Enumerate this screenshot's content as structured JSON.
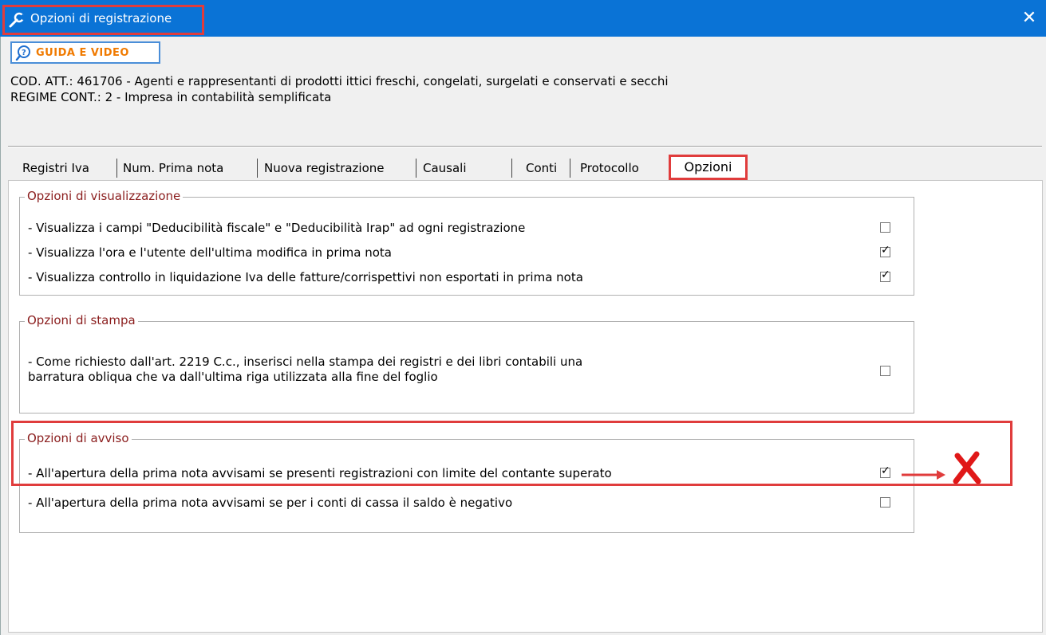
{
  "window": {
    "title": "Opzioni di registrazione",
    "close_glyph": "✕",
    "title_icon": "wrench-icon",
    "accent_color": "#0a73d6",
    "highlight_color": "#e03c3c"
  },
  "help_button": {
    "label": "GUIDA E VIDEO",
    "icon": "search-icon"
  },
  "info": {
    "activity_line": "COD. ATT.: 461706 - Agenti e rappresentanti di prodotti ittici freschi, congelati, surgelati e conservati e secchi",
    "regime_line": "REGIME CONT.: 2 - Impresa  in contabilità semplificata"
  },
  "tabs": [
    {
      "label": "Registri Iva"
    },
    {
      "label": "Num. Prima nota"
    },
    {
      "label": "Nuova registrazione"
    },
    {
      "label": "Causali"
    },
    {
      "label": "Conti"
    },
    {
      "label": "Protocollo"
    },
    {
      "label": "Opzioni",
      "active": true
    }
  ],
  "groups": {
    "visualizzazione": {
      "title": "Opzioni di visualizzazione",
      "options": [
        {
          "label": "- Visualizza i campi \"Deducibilità fiscale\" e \"Deducibilità Irap\" ad ogni registrazione",
          "checked": false
        },
        {
          "label": "- Visualizza l'ora e l'utente dell'ultima modifica in prima nota",
          "checked": true
        },
        {
          "label": "- Visualizza controllo in liquidazione Iva delle fatture/corrispettivi non esportati in prima nota",
          "checked": true
        }
      ]
    },
    "stampa": {
      "title": "Opzioni di stampa",
      "options": [
        {
          "label_line1": "- Come richiesto dall'art. 2219 C.c., inserisci nella stampa dei registri e dei libri contabili una",
          "label_line2": "barratura obliqua che va dall'ultima riga utilizzata alla fine del foglio",
          "checked": false
        }
      ]
    },
    "avviso": {
      "title": "Opzioni di avviso",
      "options": [
        {
          "label": "- All'apertura della prima nota avvisami se presenti registrazioni con limite del contante superato",
          "checked": true
        },
        {
          "label": "- All'apertura della prima nota avvisami se per i conti di cassa il saldo è negativo",
          "checked": false
        }
      ]
    }
  }
}
